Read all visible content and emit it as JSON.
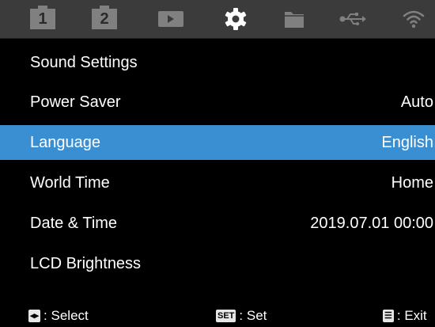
{
  "tabs": [
    {
      "name": "tab-shooting-1",
      "label": "1",
      "active": false
    },
    {
      "name": "tab-shooting-2",
      "label": "2",
      "active": false
    },
    {
      "name": "tab-playback",
      "active": false
    },
    {
      "name": "tab-setup",
      "active": true
    },
    {
      "name": "tab-files",
      "active": false
    },
    {
      "name": "tab-usb",
      "active": false
    },
    {
      "name": "tab-wifi",
      "active": false
    }
  ],
  "menu": {
    "items": [
      {
        "label": "Sound Settings",
        "value": ""
      },
      {
        "label": "Power Saver",
        "value": "Auto"
      },
      {
        "label": "Language",
        "value": "English",
        "selected": true
      },
      {
        "label": "World Time",
        "value": "Home"
      },
      {
        "label": "Date & Time",
        "value": "2019.07.01 00:00"
      },
      {
        "label": "LCD Brightness",
        "value": ""
      }
    ]
  },
  "footer": {
    "select_key": "◂▸",
    "select_label": ": Select",
    "set_key": "SET",
    "set_label": ": Set",
    "exit_key": "☰",
    "exit_label": ": Exit"
  },
  "colors": {
    "tabbar": "#3b3b3b",
    "icon_inactive": "#808080",
    "icon_active": "#ffffff",
    "selection": "#3a8fd3",
    "background": "#000000"
  }
}
